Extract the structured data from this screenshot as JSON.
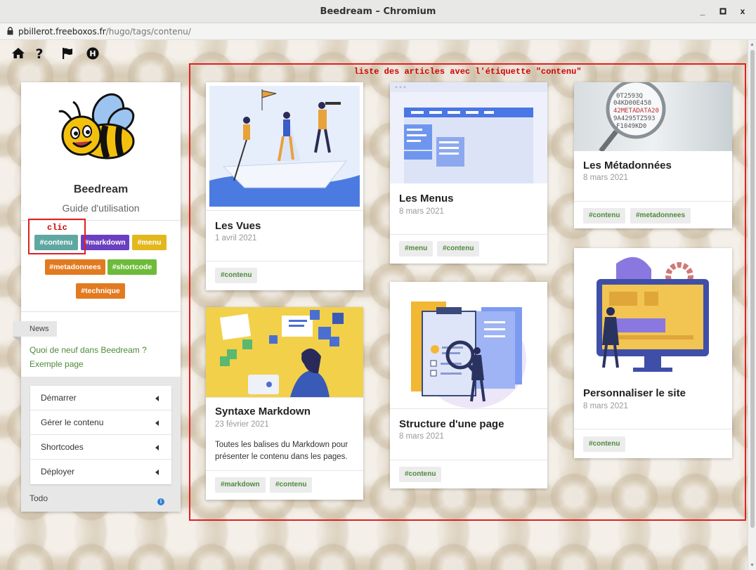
{
  "window": {
    "title": "Beedream – Chromium",
    "min": "_",
    "max": "▫",
    "close": "x"
  },
  "address": {
    "host": "pbillerot.freeboxos.fr",
    "path": "/hugo/tags/contenu/"
  },
  "site": {
    "name": "Beedream",
    "subtitle": "Guide d'utilisation"
  },
  "tags": [
    {
      "label": "#contenu",
      "color": "#5fa8a2"
    },
    {
      "label": "#markdown",
      "color": "#6b3fc1"
    },
    {
      "label": "#menu",
      "color": "#e3b81e"
    },
    {
      "label": "#metadonnees",
      "color": "#e27a20"
    },
    {
      "label": "#shortcode",
      "color": "#6dbb3a"
    },
    {
      "label": "#technique",
      "color": "#e27a20"
    }
  ],
  "annotations": {
    "clic": "clic",
    "caption": "liste des articles avec l'étiquette \"contenu\""
  },
  "news": {
    "tab": "News",
    "links": [
      "Quoi de neuf dans Beedream ?",
      "Exemple page"
    ]
  },
  "menu": [
    "Démarrer",
    "Gérer le contenu",
    "Shortcodes",
    "Déployer"
  ],
  "todo": "Todo",
  "cards": [
    {
      "title": "Les Vues",
      "date": "1 avril 2021",
      "desc": "",
      "tags": [
        "#contenu"
      ]
    },
    {
      "title": "Syntaxe Markdown",
      "date": "23 février 2021",
      "desc": "Toutes les balises du Markdown pour présenter le contenu dans les pages.",
      "tags": [
        "#markdown",
        "#contenu"
      ]
    },
    {
      "title": "Les Menus",
      "date": "8 mars 2021",
      "desc": "",
      "tags": [
        "#menu",
        "#contenu"
      ]
    },
    {
      "title": "Structure d'une page",
      "date": "8 mars 2021",
      "desc": "",
      "tags": [
        "#contenu"
      ]
    },
    {
      "title": "Les Métadonnées",
      "date": "8 mars 2021",
      "desc": "",
      "tags": [
        "#contenu",
        "#metadonnees"
      ]
    },
    {
      "title": "Personnaliser le site",
      "date": "8 mars 2021",
      "desc": "",
      "tags": [
        "#contenu"
      ]
    }
  ],
  "icons": [
    "home-icon",
    "help-icon",
    "flag-icon",
    "hugo-icon"
  ]
}
